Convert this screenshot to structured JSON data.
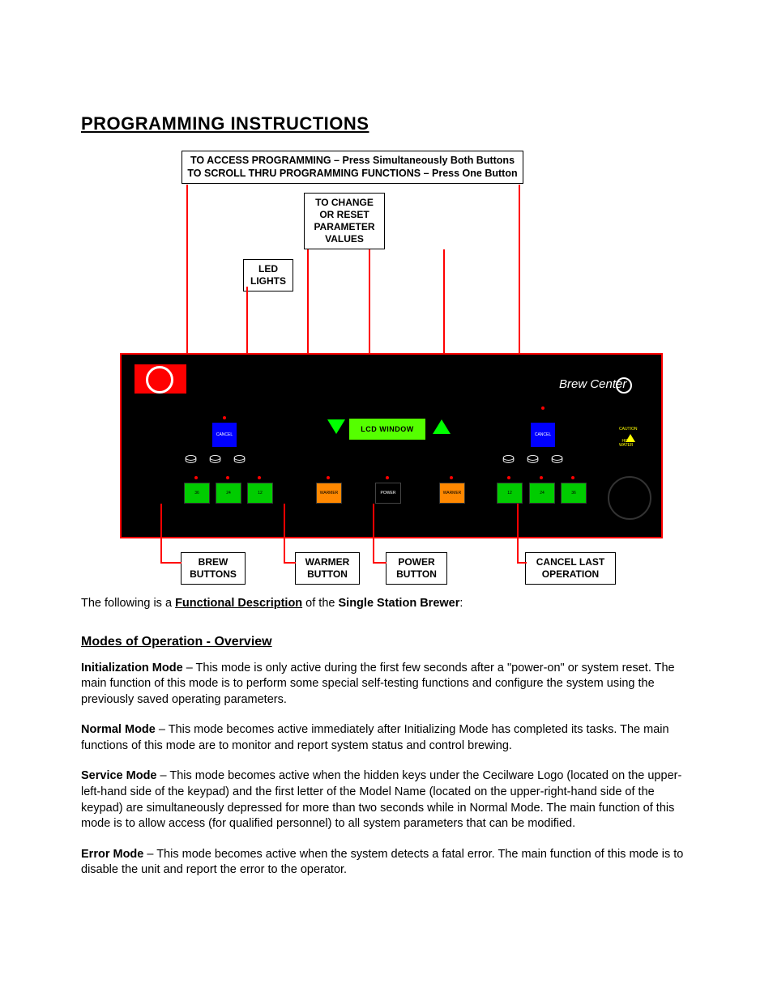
{
  "title": "PROGRAMMING INSTRUCTIONS",
  "callouts": {
    "access": "TO ACCESS PROGRAMMING – Press Simultaneously Both Buttons",
    "scroll": "TO SCROLL THRU PROGRAMMING FUNCTIONS – Press One Button",
    "change": "TO CHANGE OR RESET PARAMETER VALUES",
    "led": "LED LIGHTS",
    "brew": "BREW BUTTONS",
    "warmer": "WARMER BUTTON",
    "power": "POWER BUTTON",
    "cancel": "CANCEL LAST OPERATION"
  },
  "panel": {
    "lcd": "LCD  WINDOW",
    "brand": "Brew Center",
    "cancel": "CANCEL",
    "b36": "36",
    "b24": "24",
    "b12": "12",
    "warmer": "WARMER",
    "power": "POWER",
    "caution": "CAUTION",
    "hot": "HOT WATER"
  },
  "intro_pre": "The following is a ",
  "intro_fd": "Functional Description",
  "intro_mid": " of the ",
  "intro_ssb": "Single Station Brewer",
  "intro_end": ":",
  "h_modes": "Modes of Operation - Overview",
  "modes": {
    "init_h": "Initialization Mode",
    "init_b": " – This mode is only active during the first few seconds after a \"power-on\" or system reset.  The main function of this mode is to perform some special self-testing functions and configure the system using the previously saved operating parameters.",
    "norm_h": "Normal Mode",
    "norm_b": " – This mode becomes active immediately after Initializing Mode has completed its tasks.  The main functions of this mode are to monitor and report system status and control brewing.",
    "serv_h": "Service Mode",
    "serv_b": " – This mode becomes active when the hidden keys under the Cecilware Logo (located on the upper-left-hand side of the keypad) and the first letter of the Model Name (located on the upper-right-hand side of the keypad) are simultaneously depressed for more than two seconds while in Normal Mode.  The main function of this mode is to allow access (for qualified personnel) to all system parameters that can be modified.",
    "err_h": "Error Mode",
    "err_b": " – This mode becomes active when the system detects a fatal error.  The main function of this mode is to disable the unit and report the error to the operator."
  }
}
